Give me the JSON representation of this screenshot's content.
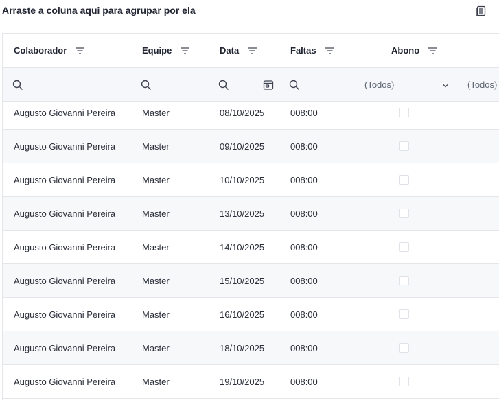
{
  "group_panel": {
    "text": "Arraste a coluna aqui para agrupar por ela"
  },
  "columns": [
    {
      "key": "colaborador",
      "label": "Colaborador"
    },
    {
      "key": "equipe",
      "label": "Equipe"
    },
    {
      "key": "data",
      "label": "Data"
    },
    {
      "key": "faltas",
      "label": "Faltas"
    },
    {
      "key": "abono",
      "label": "Abono"
    }
  ],
  "filter": {
    "abono_value": "(Todos)",
    "next_col_value": "(Todos)"
  },
  "rows": [
    {
      "colaborador": "Augusto Giovanni Pereira",
      "equipe": "Master",
      "data": "08/10/2025",
      "faltas": "008:00"
    },
    {
      "colaborador": "Augusto Giovanni Pereira",
      "equipe": "Master",
      "data": "09/10/2025",
      "faltas": "008:00"
    },
    {
      "colaborador": "Augusto Giovanni Pereira",
      "equipe": "Master",
      "data": "10/10/2025",
      "faltas": "008:00"
    },
    {
      "colaborador": "Augusto Giovanni Pereira",
      "equipe": "Master",
      "data": "13/10/2025",
      "faltas": "008:00"
    },
    {
      "colaborador": "Augusto Giovanni Pereira",
      "equipe": "Master",
      "data": "14/10/2025",
      "faltas": "008:00"
    },
    {
      "colaborador": "Augusto Giovanni Pereira",
      "equipe": "Master",
      "data": "15/10/2025",
      "faltas": "008:00"
    },
    {
      "colaborador": "Augusto Giovanni Pereira",
      "equipe": "Master",
      "data": "16/10/2025",
      "faltas": "008:00"
    },
    {
      "colaborador": "Augusto Giovanni Pereira",
      "equipe": "Master",
      "data": "18/10/2025",
      "faltas": "008:00"
    },
    {
      "colaborador": "Augusto Giovanni Pereira",
      "equipe": "Master",
      "data": "19/10/2025",
      "faltas": "008:00"
    }
  ]
}
